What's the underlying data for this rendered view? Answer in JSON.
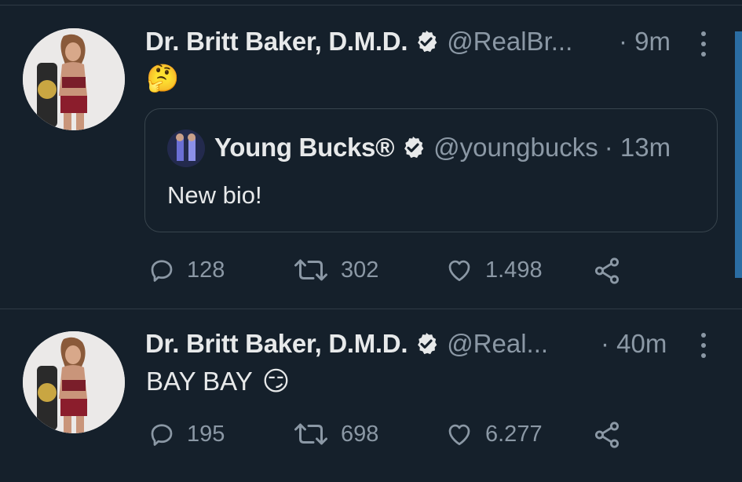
{
  "tweets": [
    {
      "name": "Dr. Britt Baker, D.M.D.",
      "handle": "@RealBr...",
      "time": "· 9m",
      "emoji": "🤔",
      "quote": {
        "name": "Young Bucks®",
        "handle": "@youngbucks",
        "time": "· 13m",
        "text": "New bio!"
      },
      "replies": "128",
      "retweets": "302",
      "likes": "1.498"
    },
    {
      "name": "Dr. Britt Baker, D.M.D.",
      "handle": "@Real...",
      "time": "· 40m",
      "text": "BAY BAY",
      "emoji": "😏",
      "replies": "195",
      "retweets": "698",
      "likes": "6.277"
    }
  ],
  "colors": {
    "background": "#15202b",
    "text": "#e7e9ea",
    "secondary": "#8b98a5",
    "border": "#38444d",
    "scrollbar": "#2b6da3"
  }
}
